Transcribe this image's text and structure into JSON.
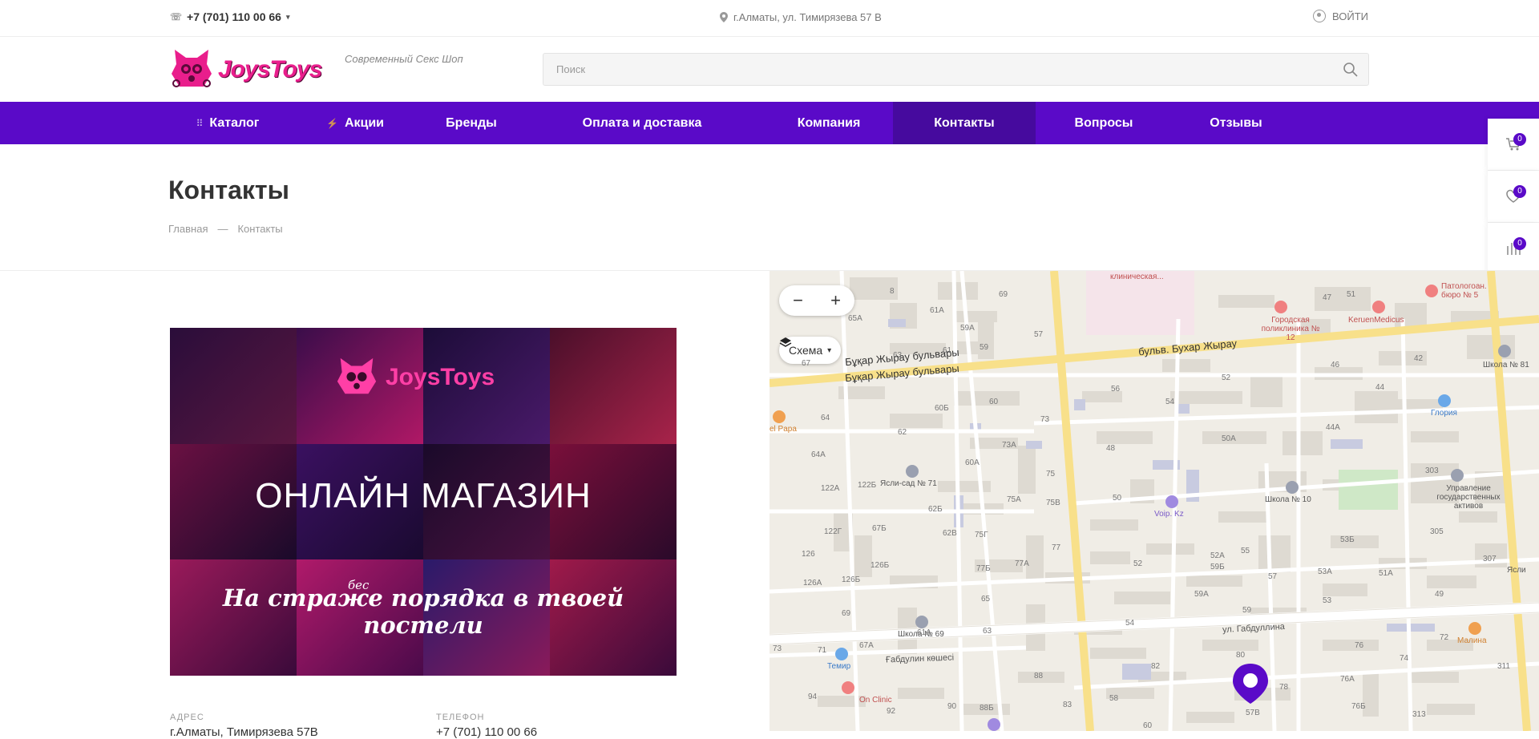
{
  "topbar": {
    "phone": "+7 (701) 110 00 66",
    "address": "г.Алматы, ул. Тимирязева 57 В",
    "login": "ВОЙТИ"
  },
  "header": {
    "logo_text": "JoysToys",
    "tagline": "Современный Секс Шоп",
    "search_placeholder": "Поиск"
  },
  "nav": {
    "items": [
      {
        "label": "Каталог",
        "icon": "grid-icon"
      },
      {
        "label": "Акции",
        "icon": "lightning-icon"
      },
      {
        "label": "Бренды"
      },
      {
        "label": "Оплата и доставка"
      },
      {
        "label": "Компания"
      },
      {
        "label": "Контакты",
        "active": true
      },
      {
        "label": "Вопросы"
      },
      {
        "label": "Отзывы"
      }
    ]
  },
  "side": {
    "cart_count": "0",
    "favorites_count": "0",
    "compare_count": "0"
  },
  "page": {
    "title": "Контакты",
    "breadcrumb_home": "Главная",
    "breadcrumb_sep": "—",
    "breadcrumb_current": "Контакты"
  },
  "banner": {
    "logo_text": "JoysToys",
    "title": "ОНЛАЙН МАГАЗИН",
    "subtitle": "На страже порядка в твоей постели",
    "subtitle_insert": "бес"
  },
  "info": {
    "address_label": "АДРЕС",
    "address_value": "г.Алматы, Тимирязева 57В",
    "phone_label": "ТЕЛЕФОН",
    "phone_value": "+7 (701) 110 00 66"
  },
  "map": {
    "layers_label": "Схема",
    "streets": {
      "bukhar_kz_1": "Бұқар Жырау бульвары",
      "bukhar_kz_2": "Бұқар Жырау бульвары",
      "bukhar_ru": "бульв. Бухар Жырау",
      "gabdullina_ru": "ул. Габдуллина",
      "gabdullin_kz": "Ғабдулин көшесі"
    },
    "pois": {
      "klin": "клиническая...",
      "polyclinic": "Городская поликлиника № 12",
      "keruen": "KeruenMedicus",
      "pathology": "Патологоан. бюро № 5",
      "school81": "Школа № 81",
      "gloria": "Глория",
      "nursery": "Ясли-сад № 71",
      "voip": "Voip. Kz",
      "school10": "Школа № 10",
      "mgmt": "Управление государственных активов",
      "school69": "Школа № 69",
      "temir": "Темир",
      "onclinic": "On Clinic",
      "malina": "Малина",
      "papa": "el Papa",
      "yasli": "Ясли"
    },
    "house_numbers": [
      "8",
      "69",
      "61А",
      "65А",
      "59А",
      "57",
      "63",
      "61",
      "59",
      "67",
      "60Б",
      "60",
      "73",
      "64",
      "62",
      "56",
      "54",
      "52",
      "48",
      "47",
      "46",
      "42",
      "44",
      "44А",
      "50А",
      "60А",
      "73А",
      "75",
      "64А",
      "122А",
      "122Б",
      "62Б",
      "75А",
      "75В",
      "50",
      "122Г",
      "67Б",
      "62В",
      "75Г",
      "126",
      "126Б",
      "77Б",
      "77А",
      "77",
      "126А",
      "126Б",
      "65",
      "69",
      "63",
      "67А",
      "71",
      "73",
      "88",
      "94",
      "92",
      "90",
      "88Б",
      "83",
      "58",
      "82",
      "80",
      "78",
      "76",
      "74",
      "72",
      "76А",
      "76Б",
      "313",
      "311",
      "305",
      "307",
      "303",
      "53Б",
      "53А",
      "51А",
      "53",
      "49",
      "55",
      "57",
      "59",
      "59А",
      "59Б",
      "52",
      "52А",
      "54",
      "57В",
      "60",
      "61А",
      "51"
    ]
  }
}
